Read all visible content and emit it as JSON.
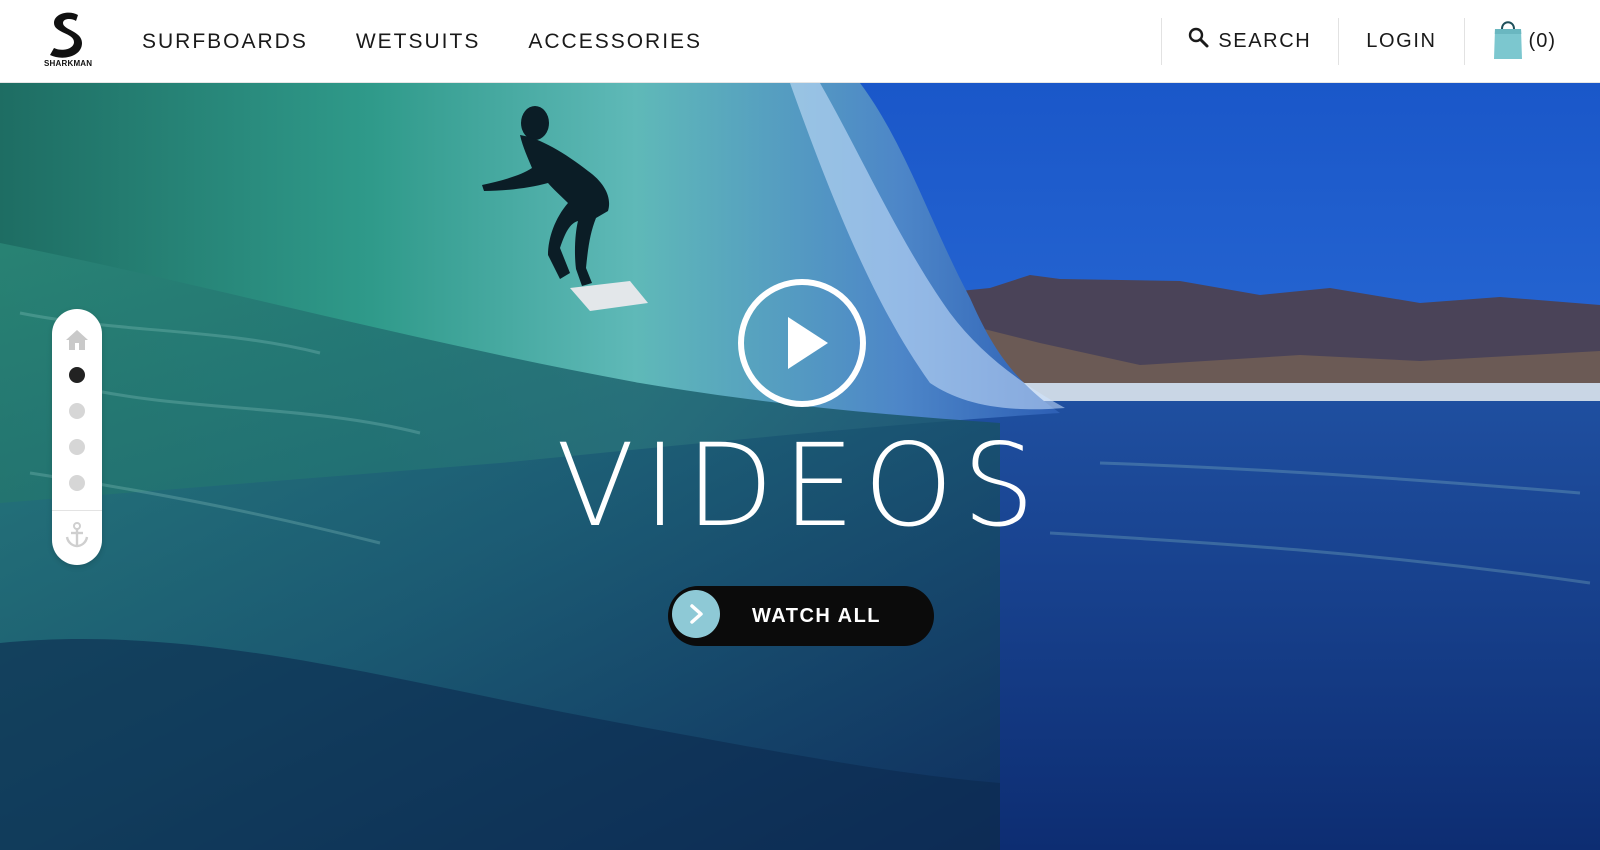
{
  "brand": {
    "logo_text": "SHARKMAN"
  },
  "nav": {
    "items": [
      {
        "label": "SURFBOARDS"
      },
      {
        "label": "WETSUITS"
      },
      {
        "label": "ACCESSORIES"
      }
    ]
  },
  "header_right": {
    "search_label": "SEARCH",
    "login_label": "LOGIN",
    "cart_count": "(0)",
    "cart_icon_color": "#7cc7cf"
  },
  "hero": {
    "title": "VIDEOS",
    "cta_label": "WATCH ALL",
    "cta_accent": "#8ec9d6"
  },
  "side_nav": {
    "icons": [
      "home-icon",
      "anchor-icon"
    ],
    "dots": [
      {
        "active": true
      },
      {
        "active": false
      },
      {
        "active": false
      },
      {
        "active": false
      }
    ]
  },
  "colors": {
    "header_bg": "#ffffff",
    "text": "#1a1a1a",
    "cta_bg": "#0b0b0b"
  }
}
